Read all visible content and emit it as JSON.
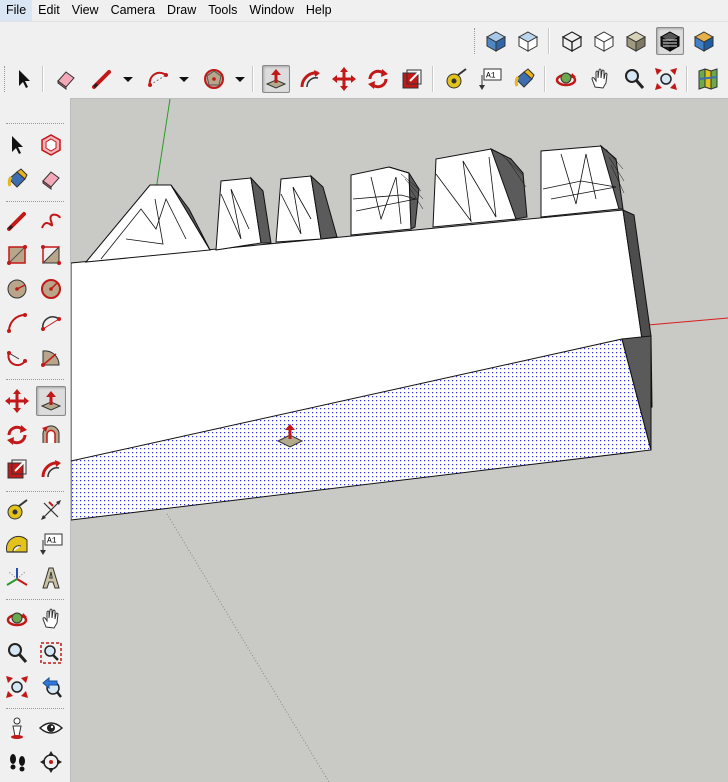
{
  "menu": [
    "File",
    "Edit",
    "View",
    "Camera",
    "Draw",
    "Tools",
    "Window",
    "Help"
  ],
  "tools": {
    "text_label": "A1",
    "dimension_label": "A1"
  },
  "colors": {
    "window_bg": "#f0f0f0",
    "viewport_bg": "#c9c9c6",
    "accent_red": "#d81e1e",
    "selected_face": "#2b2be0"
  }
}
